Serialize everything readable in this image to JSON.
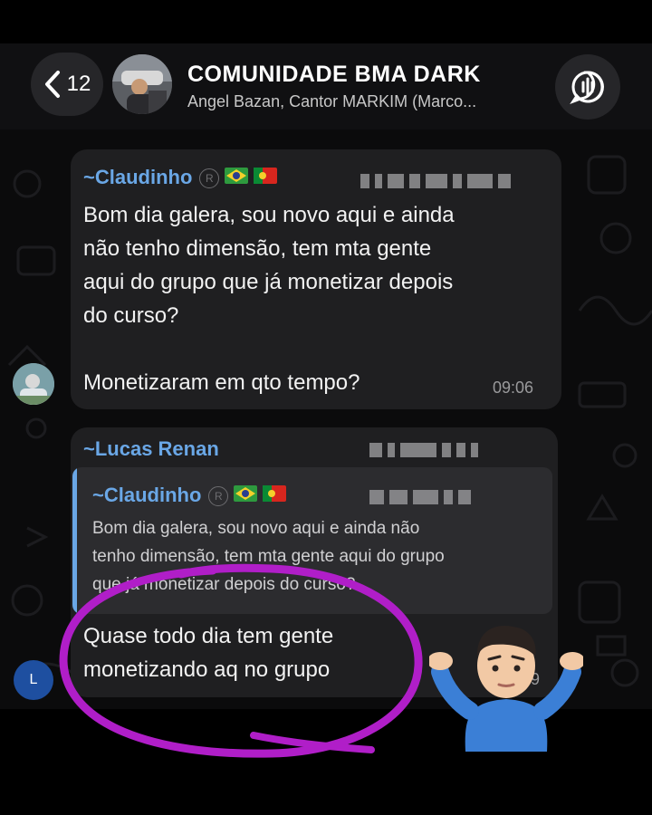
{
  "header": {
    "back_count": "12",
    "title": "COMUNIDADE BMA DARK",
    "subtitle": "Angel Bazan, Cantor MARKIM (Marco..."
  },
  "messages": [
    {
      "sender": "~Claudinho",
      "text_lines": [
        "Bom dia galera, sou novo aqui e ainda",
        "não tenho dimensão, tem mta gente",
        "aqui do grupo que já monetizar depois",
        "do curso?"
      ],
      "text_last": "Monetizaram em qto tempo?",
      "time": "09:06"
    },
    {
      "sender": "~Lucas Renan",
      "quote": {
        "sender": "~Claudinho",
        "text_lines": [
          "Bom dia galera, sou novo aqui e ainda não",
          "tenho dimensão, tem mta gente aqui do grupo",
          "que já monetizar depois do curso?"
        ]
      },
      "text_lines": [
        "Quase todo dia tem gente",
        "monetizando aq no grupo"
      ],
      "avatar_letter": "L",
      "time_fragment": "9"
    }
  ],
  "colors": {
    "sender_blue": "#6aa7e6",
    "annotation_purple": "#b01ec8",
    "bubble": "#1f1f21"
  },
  "icons": [
    "chevron-left-icon",
    "audio-chat-icon",
    "registered-icon",
    "brazil-flag-icon",
    "portugal-flag-icon",
    "shrug-emoji"
  ]
}
